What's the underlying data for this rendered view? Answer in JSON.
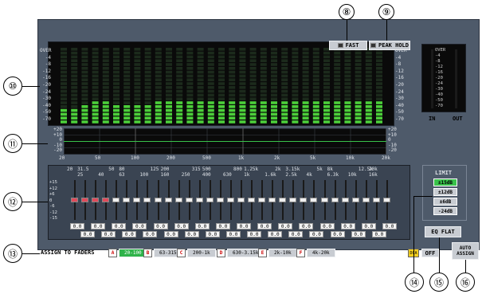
{
  "callouts": [
    "⑧",
    "⑨",
    "⑩",
    "⑪",
    "⑫",
    "⑬",
    "⑭",
    "⑮",
    "⑯"
  ],
  "meter": {
    "fast_label": "FAST",
    "peak_hold_label": "PEAK HOLD",
    "scale": [
      "OVER",
      "-4",
      "-8",
      "-12",
      "-16",
      "-20",
      "-24",
      "-30",
      "-40",
      "-50",
      "-70"
    ],
    "bars": [
      8,
      8,
      10,
      11,
      11,
      10,
      10,
      10,
      10,
      11,
      11,
      11,
      11,
      11,
      12,
      12,
      12,
      11,
      11,
      11,
      11,
      11,
      12,
      11,
      11,
      11,
      12,
      12,
      11,
      11,
      11
    ]
  },
  "output_meter": {
    "scale": [
      "OVER",
      "-4",
      "-8",
      "-12",
      "-16",
      "-20",
      "-24",
      "-30",
      "-40",
      "-50",
      "-70"
    ],
    "in_label": "IN",
    "out_label": "OUT"
  },
  "curve": {
    "ylabels": [
      "+20",
      "+10",
      "0",
      "-10",
      "-20"
    ],
    "xlabels": [
      "20",
      "50",
      "100",
      "200",
      "500",
      "1k",
      "2k",
      "5k",
      "10k",
      "20k"
    ]
  },
  "faders": {
    "freq_top": [
      "20",
      "50",
      "125",
      "315",
      "800",
      "2k",
      "5k",
      "12.5k"
    ],
    "freq_top2": [
      "31.5",
      "80",
      "200",
      "500",
      "1.25k",
      "3.15k",
      "8k",
      "20k"
    ],
    "freq_bottom": [
      "25",
      "40",
      "63",
      "100",
      "160",
      "250",
      "400",
      "630",
      "1k",
      "1.6k",
      "2.5k",
      "4k",
      "6.3k",
      "10k",
      "16k"
    ],
    "scale": [
      "+15",
      "+12",
      "+6",
      "0",
      "-6",
      "-12",
      "-15"
    ],
    "values_top": [
      "0.0",
      "0.0",
      "0.0",
      "0.0",
      "0.0",
      "0.0",
      "0.0",
      "0.0",
      "0.0",
      "0.0",
      "0.0",
      "0.0",
      "0.0",
      "0.0",
      "0.0",
      "0.0"
    ],
    "values_bottom": [
      "0.0",
      "0.0",
      "0.0",
      "0.0",
      "0.0",
      "0.0",
      "0.0",
      "0.0",
      "0.0",
      "0.0",
      "0.0",
      "0.0",
      "0.0",
      "0.0",
      "0.0"
    ]
  },
  "limit": {
    "title": "LIMIT",
    "options": [
      "±15dB",
      "±12dB",
      "±6dB",
      "-24dB"
    ],
    "selected": 0
  },
  "eq_flat_label": "EQ FLAT",
  "auto_assign_label": "AUTO ASSIGN",
  "assign": {
    "label": "ASSIGN TO FADERS",
    "groups": [
      {
        "tag": "A",
        "range": "20-100",
        "active": true
      },
      {
        "tag": "B",
        "range": "63-315",
        "active": false
      },
      {
        "tag": "C",
        "range": "200-1k",
        "active": false
      },
      {
        "tag": "D",
        "range": "630-3.15k",
        "active": false
      },
      {
        "tag": "E",
        "range": "2k-10k",
        "active": false
      },
      {
        "tag": "F",
        "range": "4k-20k",
        "active": false
      }
    ],
    "dca_label": "DCA",
    "off_label": "OFF"
  }
}
